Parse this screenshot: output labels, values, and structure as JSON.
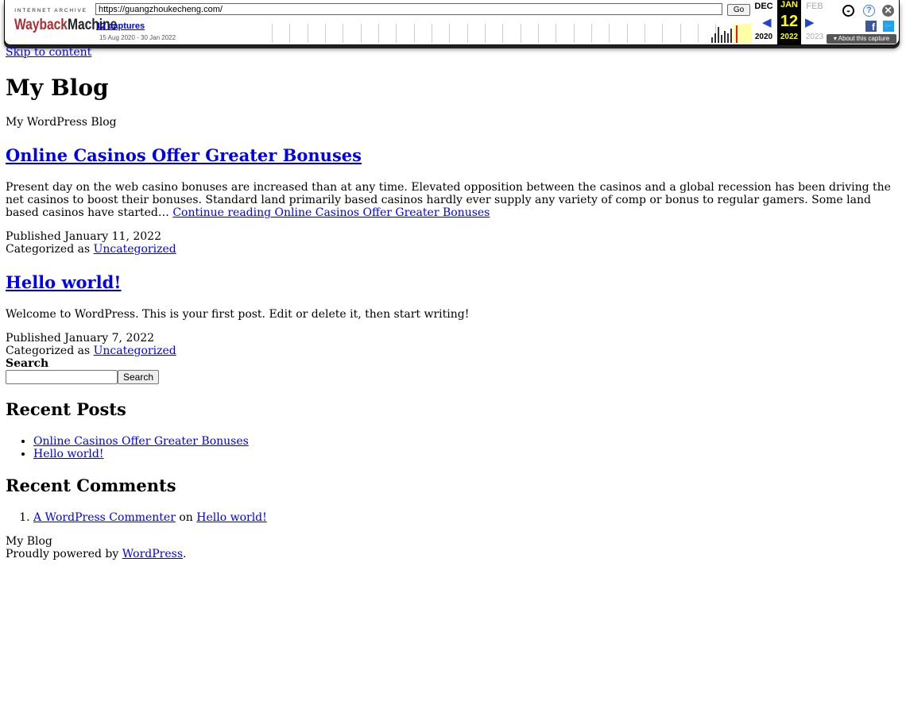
{
  "wayback": {
    "logo_top": "INTERNET ARCHIVE",
    "logo_wayback": "Wayback",
    "logo_machine": "Machine",
    "url": "https://guangzhoukecheng.com/",
    "go_label": "Go",
    "captures": "12 captures",
    "date_range": "15 Aug 2020 - 30 Jan 2022",
    "prev_month": "DEC",
    "cur_month": "JAN",
    "next_month": "FEB",
    "cur_day": "12",
    "prev_year": "2020",
    "cur_year": "2022",
    "next_year": "2023",
    "about_label": "About this capture",
    "accent_color": "#ab2e33"
  },
  "page": {
    "skip_link": "Skip to content",
    "site_title": "My Blog",
    "site_description": "My WordPress Blog",
    "posts": [
      {
        "title": "Online Casinos Offer Greater Bonuses",
        "excerpt": "Present day on the web casino bonuses are increased than at any time. Elevated opposition between the casinos and a global recession has been driving the net casinos to boost their bonuses. Standard land primarily based casinos hardly ever supply any variety of comp or bonus to regular gamers. Some land based casinos have started… ",
        "continue_prefix": "Continue reading ",
        "continue_title": "Online Casinos Offer Greater Bonuses",
        "published": "Published January 11, 2022",
        "categorized_label": "Categorized as ",
        "category": "Uncategorized"
      },
      {
        "title": "Hello world!",
        "excerpt": "Welcome to WordPress. This is your first post. Edit or delete it, then start writing!",
        "published": "Published January 7, 2022",
        "categorized_label": "Categorized as ",
        "category": "Uncategorized"
      }
    ],
    "search_label": "Search",
    "search_button": "Search",
    "search_value": "",
    "recent_posts_title": "Recent Posts",
    "recent_posts": [
      "Online Casinos Offer Greater Bonuses",
      "Hello world!"
    ],
    "recent_comments_title": "Recent Comments",
    "recent_comment": {
      "author": "A WordPress Commenter",
      "on": " on ",
      "post": "Hello world!"
    },
    "footer_site": "My Blog",
    "footer_powered_prefix": "Proudly powered by ",
    "footer_powered_link": "WordPress",
    "footer_powered_suffix": "."
  }
}
